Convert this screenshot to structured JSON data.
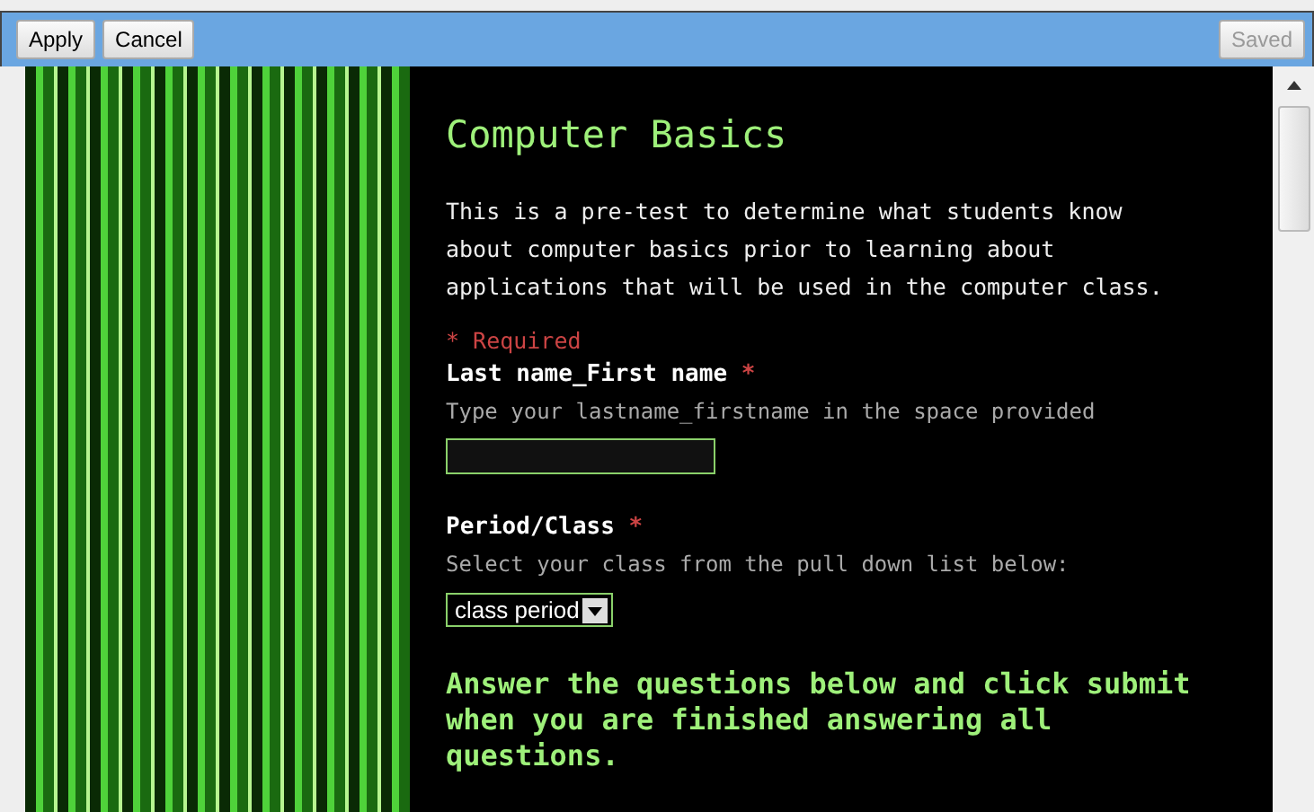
{
  "toolbar": {
    "buttons": [
      {
        "label": "Apply",
        "disabled": false
      },
      {
        "label": "Cancel",
        "disabled": false
      }
    ],
    "status_button": {
      "label": "Saved",
      "disabled": true
    }
  },
  "form": {
    "title": "Computer Basics",
    "description": "This is a pre-test to determine what students know about computer basics prior to learning about applications that will be used in the computer class.",
    "required_note": "* Required",
    "questions": [
      {
        "kind": "text",
        "label": "Last name_First name",
        "required_mark": "*",
        "help": "Type your lastname_firstname in the space provided"
      },
      {
        "kind": "select",
        "label": "Period/Class",
        "required_mark": "*",
        "help": "Select your class from the pull down list below:",
        "value": "class period"
      }
    ],
    "instructions": "Answer the questions below and click submit when you are finished answering all questions."
  }
}
